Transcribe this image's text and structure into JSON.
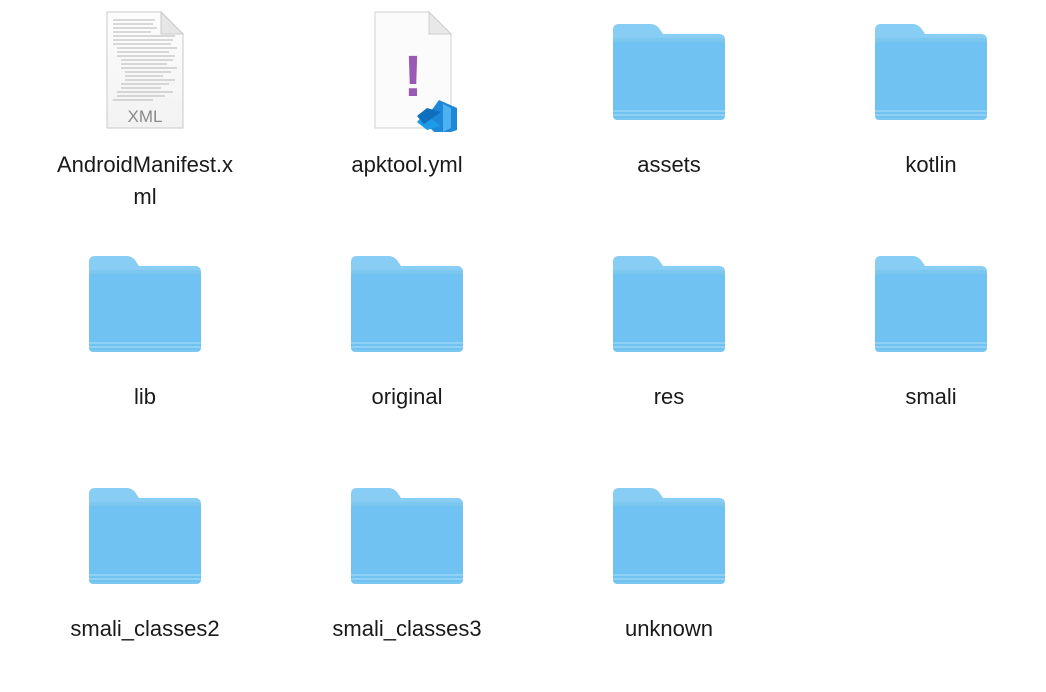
{
  "window": {
    "title": ""
  },
  "colors": {
    "folder_back": "#7cc7ef",
    "folder_front": "#6fc2f1",
    "folder_tab": "#88cdf3",
    "label_text": "#1a1a1a",
    "yml_exclamation": "#9b59b6",
    "vscode_blue": "#1f88d6"
  },
  "items": [
    {
      "name": "AndroidManifest.xml",
      "label": "AndroidManifest.x\nml",
      "kind": "file",
      "icon": "xml-file-icon",
      "badge": "XML"
    },
    {
      "name": "apktool.yml",
      "label": "apktool.yml",
      "kind": "file",
      "icon": "yml-file-icon",
      "badge": "!"
    },
    {
      "name": "assets",
      "label": "assets",
      "kind": "folder",
      "icon": "folder-icon"
    },
    {
      "name": "kotlin",
      "label": "kotlin",
      "kind": "folder",
      "icon": "folder-icon"
    },
    {
      "name": "lib",
      "label": "lib",
      "kind": "folder",
      "icon": "folder-icon"
    },
    {
      "name": "original",
      "label": "original",
      "kind": "folder",
      "icon": "folder-icon"
    },
    {
      "name": "res",
      "label": "res",
      "kind": "folder",
      "icon": "folder-icon"
    },
    {
      "name": "smali",
      "label": "smali",
      "kind": "folder",
      "icon": "folder-icon"
    },
    {
      "name": "smali_classes2",
      "label": "smali_classes2",
      "kind": "folder",
      "icon": "folder-icon"
    },
    {
      "name": "smali_classes3",
      "label": "smali_classes3",
      "kind": "folder",
      "icon": "folder-icon"
    },
    {
      "name": "unknown",
      "label": "unknown",
      "kind": "folder",
      "icon": "folder-icon"
    }
  ]
}
